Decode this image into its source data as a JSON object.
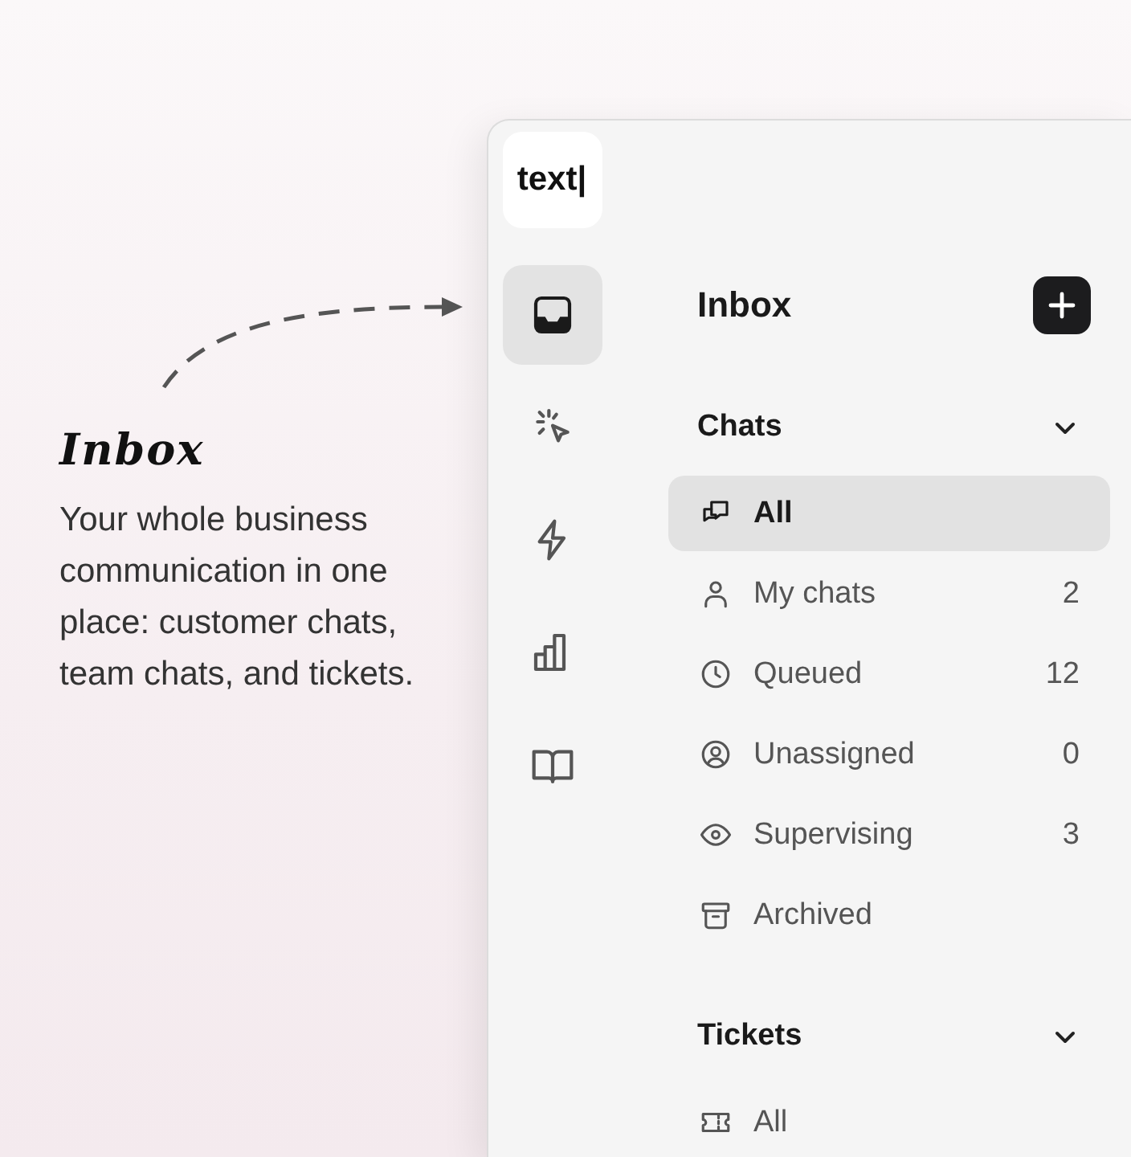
{
  "callout": {
    "title": "Inbox",
    "text": "Your whole business communication in one place: customer chats, team chats, and tickets."
  },
  "app": {
    "logo": "text|",
    "rail": [
      {
        "selected": true
      },
      {
        "selected": false
      },
      {
        "selected": false
      },
      {
        "selected": false
      },
      {
        "selected": false
      }
    ],
    "header": {
      "title": "Inbox"
    },
    "sections": [
      {
        "title": "Chats",
        "expanded": true,
        "items": [
          {
            "label": "All",
            "selected": true
          },
          {
            "label": "My chats",
            "count": "2",
            "selected": false
          },
          {
            "label": "Queued",
            "count": "12",
            "selected": false
          },
          {
            "label": "Unassigned",
            "count": "0",
            "selected": false
          },
          {
            "label": "Supervising",
            "count": "3",
            "selected": false
          },
          {
            "label": "Archived",
            "selected": false
          }
        ]
      },
      {
        "title": "Tickets",
        "expanded": true,
        "items": [
          {
            "label": "All",
            "selected": false
          }
        ]
      }
    ]
  }
}
